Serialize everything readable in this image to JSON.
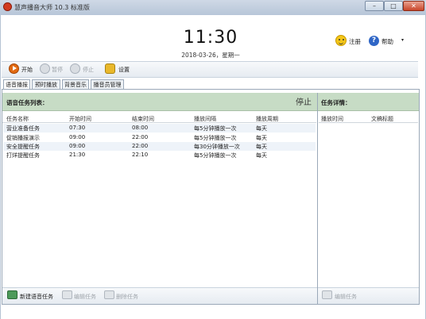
{
  "window": {
    "title": "慧声播音大师 10.3 标准版",
    "minimize": "–",
    "maximize": "□",
    "close": "✕"
  },
  "header": {
    "time": "11:30",
    "date": "2018-03-26，星期一",
    "register_label": "注册",
    "help_label": "帮助",
    "help_menu_arrow": "▾"
  },
  "toolbar": {
    "start_label": "开始",
    "pause_label": "暂停",
    "stop_label": "停止",
    "settings_label": "设置"
  },
  "tabs": [
    {
      "label": "语音播报",
      "active": true
    },
    {
      "label": "预时播放",
      "active": false
    },
    {
      "label": "背景音乐",
      "active": false
    },
    {
      "label": "播音员管理",
      "active": false
    }
  ],
  "task_list": {
    "title": "语音任务列表：",
    "status": "停止",
    "columns": [
      "任务名称",
      "开始时间",
      "结束时间",
      "播放间隔",
      "播放周期"
    ],
    "rows": [
      [
        "营业准备任务",
        "07:30",
        "08:00",
        "每5分钟播放一次",
        "每天"
      ],
      [
        "促销播报演示",
        "09:00",
        "22:00",
        "每5分钟播放一次",
        "每天"
      ],
      [
        "安全提醒任务",
        "09:00",
        "22:00",
        "每30分钟播放一次",
        "每天"
      ],
      [
        "打烊提醒任务",
        "21:30",
        "22:10",
        "每5分钟播放一次",
        "每天"
      ]
    ]
  },
  "task_detail": {
    "title": "任务详情：",
    "columns": [
      "播放时间",
      "文稿标题"
    ]
  },
  "bottom_bar": {
    "new_task_label": "新建语音任务",
    "edit_task_label": "编辑任务",
    "delete_task_label": "删除任务",
    "edit_doc_label": "编辑任务"
  }
}
